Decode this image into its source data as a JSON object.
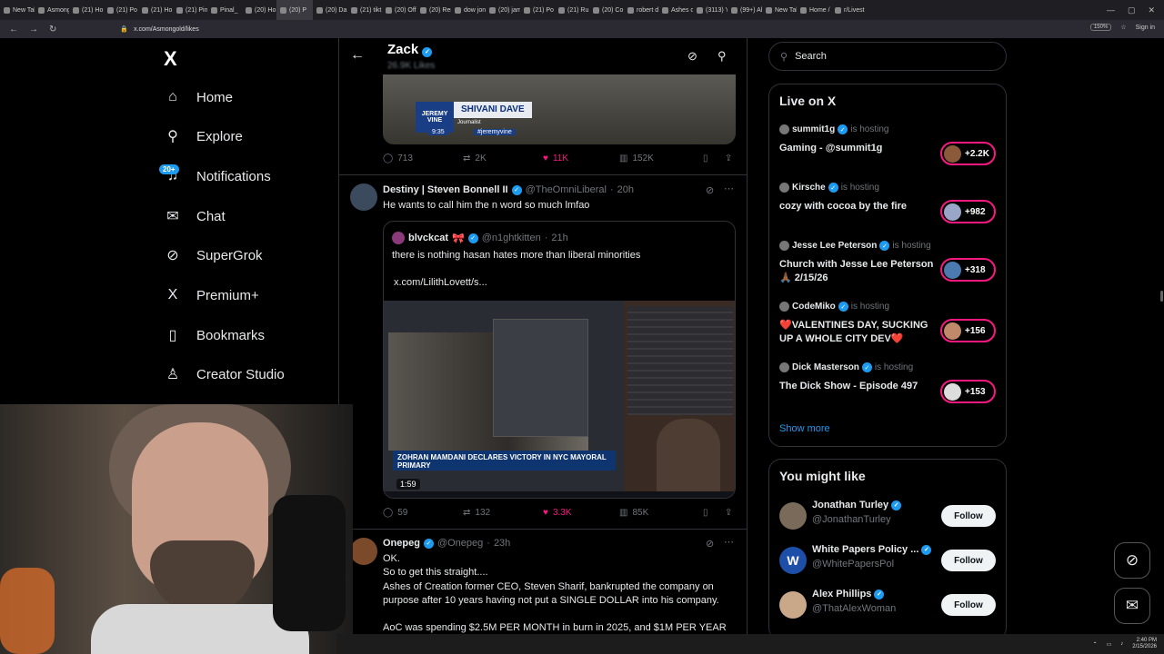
{
  "browser": {
    "tabs": [
      "New Tab",
      "Asmong",
      "(21) Ho",
      "(21) Po",
      "(21) Ho",
      "(21) Pin",
      "Pinal_",
      "(20) Ho",
      "(20) P",
      "(20) Da",
      "(21) tikt",
      "(20) Offi",
      "(20) Rem",
      "dow jon",
      "(20) jam",
      "(21) Po",
      "(21) Ru",
      "(20) Co",
      "robert d",
      "Ashes o",
      "(3113) Y",
      "(99+) Al",
      "New Tab",
      "Home /",
      "r/Livest"
    ],
    "active_tab_index": 8,
    "url": "x.com/Asmongold/likes",
    "zoom": "150%",
    "sign_in": "Sign in"
  },
  "nav": {
    "logo": "X",
    "items": [
      {
        "label": "Home",
        "icon": "home-icon",
        "glyph": "⌂"
      },
      {
        "label": "Explore",
        "icon": "search-icon",
        "glyph": "⚲"
      },
      {
        "label": "Notifications",
        "icon": "bell-icon",
        "glyph": "♫"
      },
      {
        "label": "Chat",
        "icon": "mail-icon",
        "glyph": "✉"
      },
      {
        "label": "SuperGrok",
        "icon": "grok-icon",
        "glyph": "⊘"
      },
      {
        "label": "Premium+",
        "icon": "x-premium-icon",
        "glyph": "X"
      },
      {
        "label": "Bookmarks",
        "icon": "bookmark-icon",
        "glyph": "▯"
      },
      {
        "label": "Creator Studio",
        "icon": "creator-icon",
        "glyph": "♙"
      }
    ],
    "notif_badge": "20+"
  },
  "header": {
    "name": "Zack",
    "likes": "26.9K Likes"
  },
  "tweet1": {
    "video_tag_brand": "JEREMY VINE",
    "video_tag_name": "SHIVANI DAVE",
    "video_tag_role": "Journalist",
    "video_tag_time": "9:35",
    "video_tag_handle": "#jeremyvine",
    "replies": "713",
    "reposts": "2K",
    "likes": "11K",
    "views": "152K"
  },
  "tweet2": {
    "display_name": "Destiny | Steven Bonnell II",
    "handle": "@TheOmniLiberal",
    "time": "20h",
    "text": "He wants to call him the n word so much lmfao",
    "quote": {
      "display_name": "blvckcat",
      "handle": "@n1ghtkitten",
      "time": "21h",
      "text": "there is nothing hasan hates more than liberal minorities",
      "link": "x.com/LilithLovett/s...",
      "media_headline": "ZOHRAN MAMDANI DECLARES VICTORY IN NYC MAYORAL PRIMARY",
      "media_duration": "1:59"
    },
    "replies": "59",
    "reposts": "132",
    "likes": "3.3K",
    "views": "85K"
  },
  "tweet3": {
    "display_name": "Onepeg",
    "handle": "@Onepeg",
    "time": "23h",
    "lines": [
      "OK.",
      "So to get this straight....",
      "Ashes of Creation former CEO, Steven Sharif, bankrupted the company on purpose after 10 years having not put a SINGLE DOLLAR into his company.",
      "AoC was spending $2.5M PER MONTH in burn in 2025, and $1M PER YEAR"
    ]
  },
  "search": {
    "placeholder": "Search"
  },
  "live": {
    "title": "Live on X",
    "items": [
      {
        "host": "summit1g",
        "status": "is hosting",
        "title": "Gaming - @summit1g",
        "count": "+2.2K"
      },
      {
        "host": "Kirsche",
        "status": "is hosting",
        "title": "cozy with cocoa by the fire",
        "count": "+982"
      },
      {
        "host": "Jesse Lee Peterson",
        "status": "is hosting",
        "title": "Church with Jesse Lee Peterson 🙏🏾 2/15/26",
        "count": "+318"
      },
      {
        "host": "CodeMiko",
        "status": "is hosting",
        "title": "❤️VALENTINES DAY, SUCKING UP A WHOLE CITY DEV❤️",
        "count": "+156"
      },
      {
        "host": "Dick Masterson",
        "status": "is hosting",
        "title": "The Dick Show - Episode 497",
        "count": "+153"
      }
    ],
    "show_more": "Show more"
  },
  "wtf": {
    "title": "You might like",
    "items": [
      {
        "name": "Jonathan Turley",
        "handle": "@JonathanTurley",
        "button": "Follow"
      },
      {
        "name": "White Papers Policy ...",
        "handle": "@WhitePapersPol",
        "button": "Follow"
      },
      {
        "name": "Alex Phillips",
        "handle": "@ThatAlexWoman",
        "button": "Follow"
      }
    ]
  },
  "taskbar": {
    "time": "2:40 PM",
    "date": "2/15/2026"
  }
}
